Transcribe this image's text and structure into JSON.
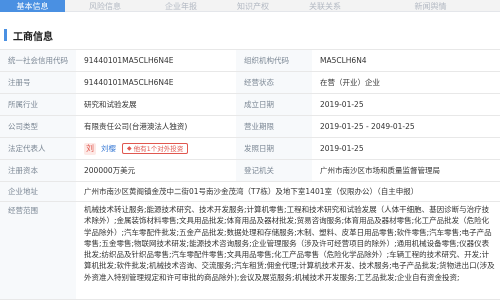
{
  "tabs": [
    "基本信息",
    "风险信息",
    "企业年报",
    "知识产权",
    "关联关系",
    "新闻舆情"
  ],
  "section_title": "工商信息",
  "fields": {
    "credit_code_label": "统一社会信用代码",
    "credit_code": "91440101MA5CLH6N4E",
    "org_code_label": "组织机构代码",
    "org_code": "MA5CLH6N4",
    "reg_no_label": "注册号",
    "reg_no": "91440101MA5CLH6N4E",
    "status_label": "经营状态",
    "status": "在营（开业）企业",
    "industry_label": "所属行业",
    "industry": "研究和试验发展",
    "est_date_label": "成立日期",
    "est_date": "2019-01-25",
    "type_label": "公司类型",
    "type": "有限责任公司(台港澳法人独资)",
    "term_label": "营业期限",
    "term": "2019-01-25 - 2049-01-25",
    "rep_label": "法定代表人",
    "rep_icon_char": "刘",
    "rep_name": "刘樱",
    "rep_btn": "他有1个对外投资",
    "issue_label": "发照日期",
    "issue_date": "2019-01-25",
    "capital_label": "注册资本",
    "capital": "200000万美元",
    "authority_label": "登记机关",
    "authority": "广州市南沙区市场和质量监督管理局",
    "address_label": "企业地址",
    "address": "广州市南沙区黄阁镇金茂中二街01号南沙金茂湾（T7栋）及地下室1401室（仅限办公）（自主申报）",
    "scope_label": "经营范围",
    "scope": "机械技术转让服务;能源技术研究、技术开发服务;计算机零售;工程和技术研究和试验发展（人体干细胞、基因诊断与治疗技术除外）;金属装饰材料零售;文具用品批发;体育用品及器材批发;贸易咨询服务;体育用品及器材零售;化工产品批发（危险化学品除外）;汽车零配件批发;五金产品批发;数据处理和存储服务;木制、塑料、皮革日用品零售;软件零售;汽车零售;电子产品零售;五金零售;物联网技术研发;能源技术咨询服务;企业管理服务（涉及许可经营项目的除外）;通用机械设备零售;仪器仪表批发;纺织品及针织品零售;汽车零配件零售;文具用品零售;化工产品零售（危险化学品除外）;车辆工程的技术研究、开发;计算机批发;软件批发;机械技术咨询、交流服务;汽车租赁;佣金代理;计算机技术开发、技术服务;电子产品批发;货物进出口(涉及外资准入特别管理规定和许可审批的商品除外);会议及展览服务;机械技术开发服务;工艺品批发;企业自有资金投资;"
  },
  "colors": {
    "accent": "#4a90e2",
    "label_bg": "#f7f9fb",
    "link": "#3a7bd5",
    "badge": "#e0574f"
  }
}
